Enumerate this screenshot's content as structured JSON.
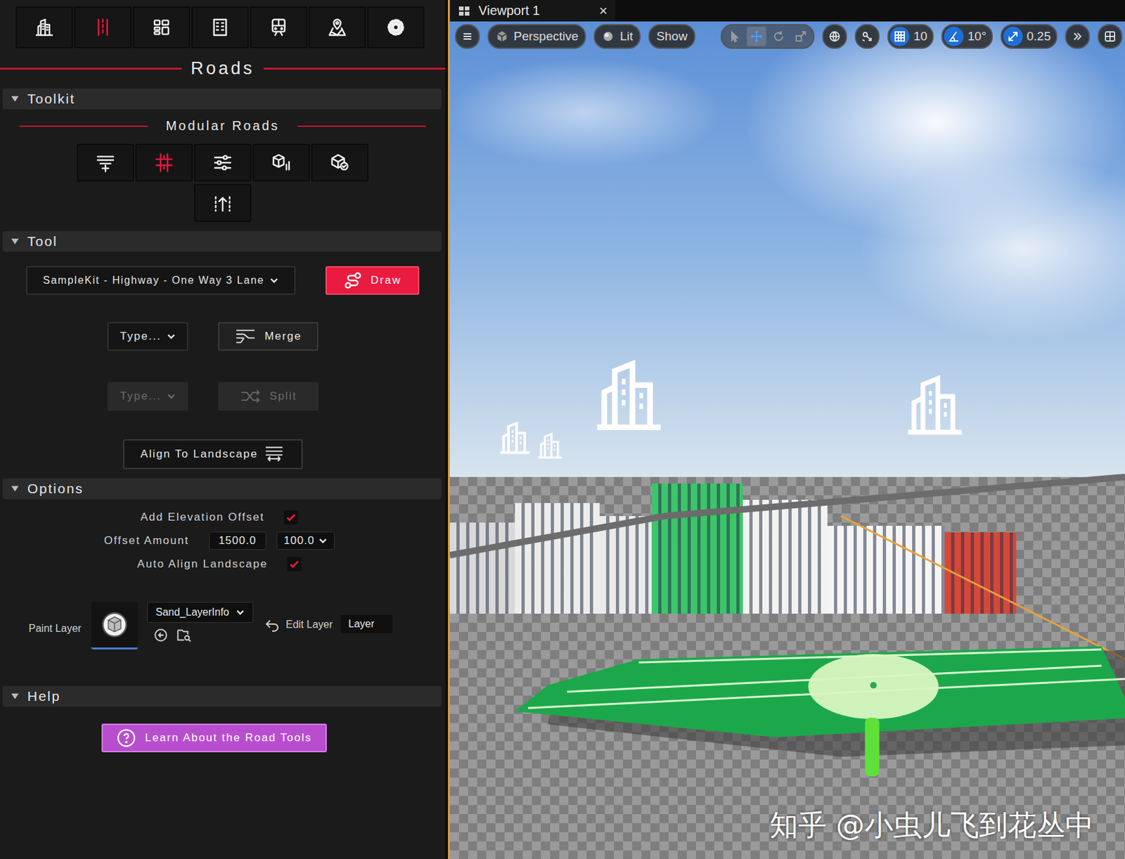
{
  "left_panel": {
    "top_tabs": [
      {
        "selected": false
      },
      {
        "selected": true
      },
      {
        "selected": false
      },
      {
        "selected": false
      },
      {
        "selected": false
      },
      {
        "selected": false
      },
      {
        "selected": false
      }
    ],
    "title": "Roads",
    "toolkit": {
      "label": "Toolkit",
      "expanded": true,
      "heading": "Modular Roads",
      "tools": [
        {
          "selected": false
        },
        {
          "selected": true
        },
        {
          "selected": false
        },
        {
          "selected": false
        },
        {
          "selected": false
        },
        {
          "selected": false
        }
      ]
    },
    "tool": {
      "label": "Tool",
      "expanded": true,
      "preset": "SampleKit - Highway - One Way 3 Lane",
      "draw_button": "Draw",
      "rows": [
        {
          "type": "Type...",
          "action": "Merge",
          "disabled": false
        },
        {
          "type": "Type...",
          "action": "Split",
          "disabled": true
        }
      ],
      "align_button": "Align To Landscape"
    },
    "options": {
      "label": "Options",
      "expanded": true,
      "add_elevation_offset": {
        "label": "Add Elevation Offset",
        "checked": true
      },
      "offset": {
        "label": "Offset Amount",
        "value": "1500.0",
        "step": "100.0"
      },
      "auto_align": {
        "label": "Auto Align Landscape",
        "checked": true
      },
      "paint_layer": {
        "label": "Paint Layer",
        "layer": "Sand_LayerInfo",
        "edit_label": "Edit Layer",
        "edit_value": "Layer"
      }
    },
    "help": {
      "label": "Help",
      "expanded": true,
      "button": "Learn About the Road Tools"
    }
  },
  "viewport": {
    "tab": "Viewport 1",
    "close": "×",
    "view_mode": "Perspective",
    "lighting": "Lit",
    "show": "Show",
    "transform_tools": [
      {
        "selected": false
      },
      {
        "selected": true
      },
      {
        "selected": false
      },
      {
        "selected": false
      }
    ],
    "grid_snap": {
      "on": true,
      "value": "10"
    },
    "angle_snap": {
      "on": true,
      "value": "10°"
    },
    "scale_snap": {
      "on": true,
      "value": "0.25"
    }
  },
  "watermark": "知乎 @小虫儿飞到花丛中"
}
